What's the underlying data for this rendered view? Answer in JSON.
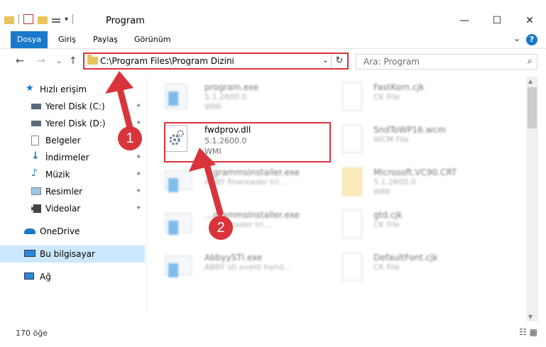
{
  "window": {
    "title": "Program",
    "minimize": "—",
    "maximize": "☐",
    "close": "✕"
  },
  "ribbon": {
    "tabs": [
      "Dosya",
      "Giriş",
      "Paylaş",
      "Görünüm"
    ],
    "expand": "⌄",
    "help": "?"
  },
  "nav": {
    "back": "←",
    "forward": "→",
    "recent": "⌄",
    "up": "↑"
  },
  "address": {
    "path": "C:\\Program Files\\Program Dizini",
    "dropdown": "⌄",
    "refresh": "↻"
  },
  "search": {
    "placeholder": "Ara: Program",
    "icon": "⌕"
  },
  "sidebar": {
    "items": [
      {
        "label": "Hızlı erişim",
        "icon": "star-icon",
        "pinned": false
      },
      {
        "label": "Yerel Disk (C:)",
        "icon": "drive-icon",
        "pinned": true
      },
      {
        "label": "Yerel Disk (D:)",
        "icon": "drive-icon",
        "pinned": true
      },
      {
        "label": "Belgeler",
        "icon": "documents-icon",
        "pinned": true
      },
      {
        "label": "İndirmeler",
        "icon": "download-icon",
        "pinned": true
      },
      {
        "label": "Müzik",
        "icon": "music-icon",
        "pinned": true
      },
      {
        "label": "Resimler",
        "icon": "pictures-icon",
        "pinned": true
      },
      {
        "label": "Videolar",
        "icon": "video-icon",
        "pinned": true
      },
      {
        "label": "OneDrive",
        "icon": "cloud-icon",
        "pinned": false
      },
      {
        "label": "Bu bilgisayar",
        "icon": "computer-icon",
        "pinned": false
      },
      {
        "label": "Ağ",
        "icon": "network-icon",
        "pinned": false
      }
    ],
    "pin_glyph": "📌"
  },
  "files": [
    {
      "name": "program.exe",
      "line2": "5.1.2600.0",
      "line3": "WMI"
    },
    {
      "name": "FastKorn.cjk",
      "line2": "CK File",
      "line3": ""
    },
    {
      "name": "fwdprov.dll",
      "line2": "5.1.2600.0",
      "line3": "WMI"
    },
    {
      "name": "SndToWP16.wcm",
      "line2": "WCM File",
      "line3": ""
    },
    {
      "name": "…grammsInstaller.exe",
      "line2": "ABBY finereader tri…",
      "line3": ""
    },
    {
      "name": "Microsoft.VC90.CRT",
      "line2": "5.1.2600.0",
      "line3": "WMI"
    },
    {
      "name": "…grammsInstaller.exe",
      "line2": "…finereader tri…",
      "line3": ""
    },
    {
      "name": "gtd.cjk",
      "line2": "CK File",
      "line3": ""
    },
    {
      "name": "AbbyySTI.exe",
      "line2": "ABBY sti event hand…",
      "line3": ""
    },
    {
      "name": "DefaultFont.cjk",
      "line2": "CK File",
      "line3": ""
    }
  ],
  "callouts": [
    "1",
    "2"
  ],
  "status": {
    "count": "170 öğe",
    "views": "☷ ▦"
  },
  "colors": {
    "accent": "#1979ca",
    "highlight": "#d9343b",
    "selected": "#cce8ff"
  }
}
